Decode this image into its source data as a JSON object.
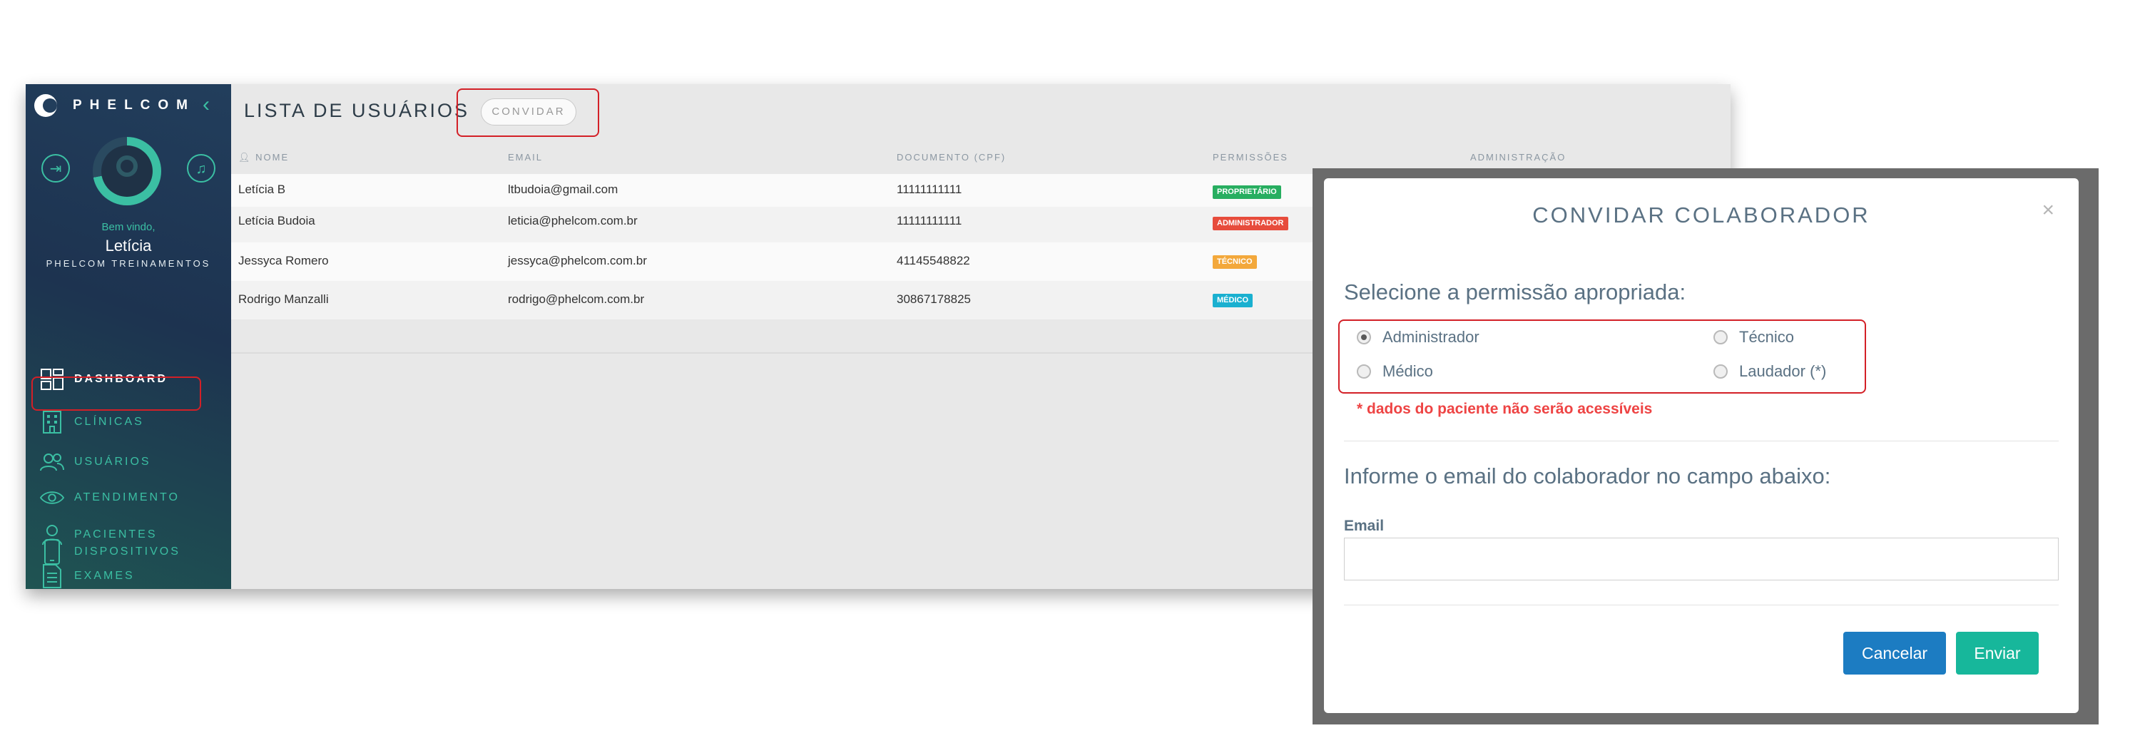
{
  "brand": {
    "name": "PHELCOM"
  },
  "user": {
    "welcome": "Bem vindo,",
    "name": "Letícia",
    "org": "PHELCOM TREINAMENTOS"
  },
  "nav": [
    {
      "label": "DASHBOARD",
      "icon": "dashboard-icon",
      "active": true
    },
    {
      "label": "CLÍNICAS",
      "icon": "building-icon"
    },
    {
      "label": "USUÁRIOS",
      "icon": "users-icon"
    },
    {
      "label": "ATENDIMENTO",
      "icon": "eye-icon"
    },
    {
      "label": "PACIENTES",
      "icon": "person-icon"
    },
    {
      "label": "EXAMES",
      "icon": "document-icon"
    },
    {
      "label": "DISPOSITIVOS",
      "icon": "device-icon"
    }
  ],
  "page": {
    "title": "LISTA DE USUÁRIOS",
    "invite_label": "CONVIDAR"
  },
  "table": {
    "headers": [
      "NOME",
      "EMAIL",
      "DOCUMENTO (CPF)",
      "PERMISSÕES",
      "ADMINISTRAÇÃO"
    ],
    "rows": [
      {
        "name": "Letícia B",
        "email": "ltbudoia@gmail.com",
        "cpf": "11111111111",
        "role": "PROPRIETÁRIO",
        "role_color": "#27ae60"
      },
      {
        "name": "Letícia Budoia",
        "email": "leticia@phelcom.com.br",
        "cpf": "11111111111",
        "role": "ADMINISTRADOR",
        "role_color": "#e74c3c"
      },
      {
        "name": "Jessyca Romero",
        "email": "jessyca@phelcom.com.br",
        "cpf": "41145548822",
        "role": "TÉCNICO",
        "role_color": "#f3a83b"
      },
      {
        "name": "Rodrigo Manzalli",
        "email": "rodrigo@phelcom.com.br",
        "cpf": "30867178825",
        "role": "MÉDICO",
        "role_color": "#1ab0d0"
      }
    ]
  },
  "modal": {
    "title": "CONVIDAR COLABORADOR",
    "close": "×",
    "permission_question": "Selecione a permissão apropriada:",
    "options": [
      {
        "label": "Administrador",
        "checked": true
      },
      {
        "label": "Técnico",
        "checked": false
      },
      {
        "label": "Médico",
        "checked": false
      },
      {
        "label": "Laudador (*)",
        "checked": false
      }
    ],
    "warning": "* dados do paciente não serão acessíveis",
    "email_question": "Informe o email do colaborador no campo abaixo:",
    "email_label": "Email",
    "email_value": "",
    "cancel_label": "Cancelar",
    "send_label": "Enviar"
  },
  "colors": {
    "accent": "#3bbfa3",
    "cancel": "#1c7cc2",
    "send": "#17b79b",
    "highlight": "#d32027",
    "warning": "#ee4444"
  }
}
